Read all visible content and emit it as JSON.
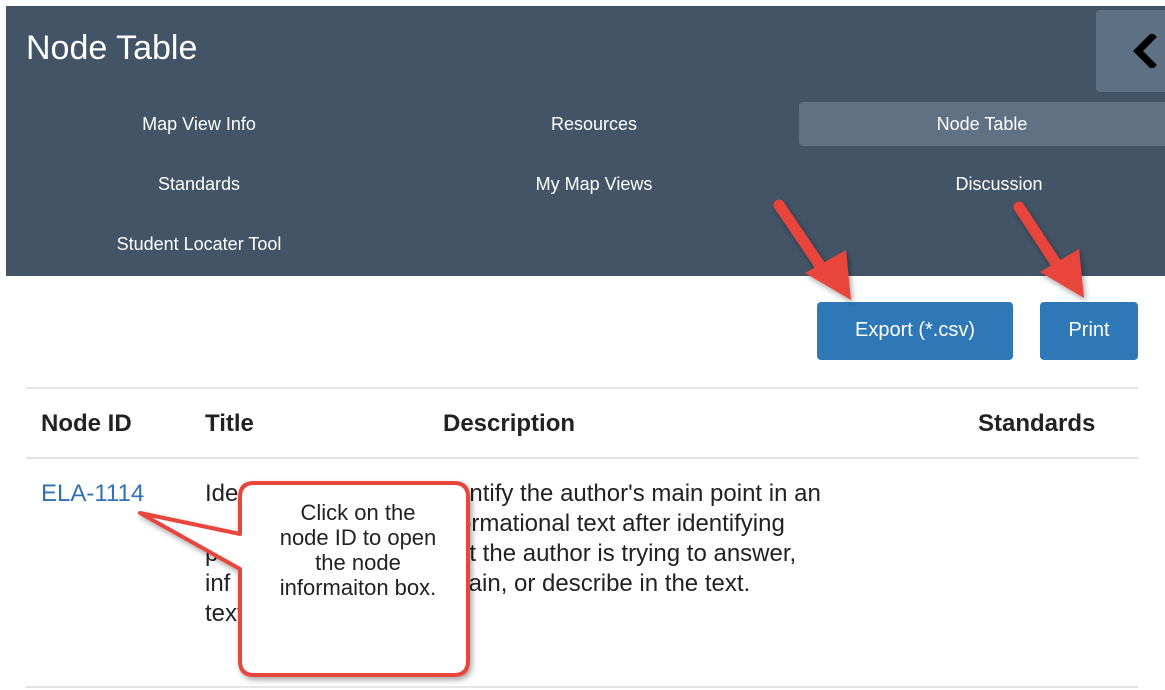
{
  "panel": {
    "title": "Node Table"
  },
  "nav": {
    "map_view_info": "Map View Info",
    "resources": "Resources",
    "node_table": "Node Table",
    "standards": "Standards",
    "my_map_views": "My Map Views",
    "discussion": "Discussion",
    "student_locater_tool": "Student Locater Tool"
  },
  "actions": {
    "export": "Export (*.csv)",
    "print": "Print"
  },
  "table": {
    "headers": {
      "node_id": "Node ID",
      "title": "Title",
      "description": "Description",
      "standards": "Standards"
    },
    "row": {
      "node_id": "ELA-1114",
      "title_lines": [
        "Ide",
        "",
        "po",
        "inf",
        "text"
      ],
      "description_lines": [
        "entify the author's main point in an",
        "ormational text after identifying",
        "at the author is trying to answer,",
        "plain, or describe in the text."
      ]
    }
  },
  "callout": {
    "lines": [
      "Click on the",
      "node ID to open",
      "the node",
      "informaiton box."
    ]
  },
  "colors": {
    "header_bg": "#435466",
    "active_tab": "#5f7183",
    "button": "#2e78b8",
    "link": "#2f72b5",
    "arrow": "#e8453c",
    "callout_border": "#e8453c"
  },
  "icons": {
    "collapse": "chevron-left-icon",
    "annotation_arrows": "arrow-icon"
  }
}
